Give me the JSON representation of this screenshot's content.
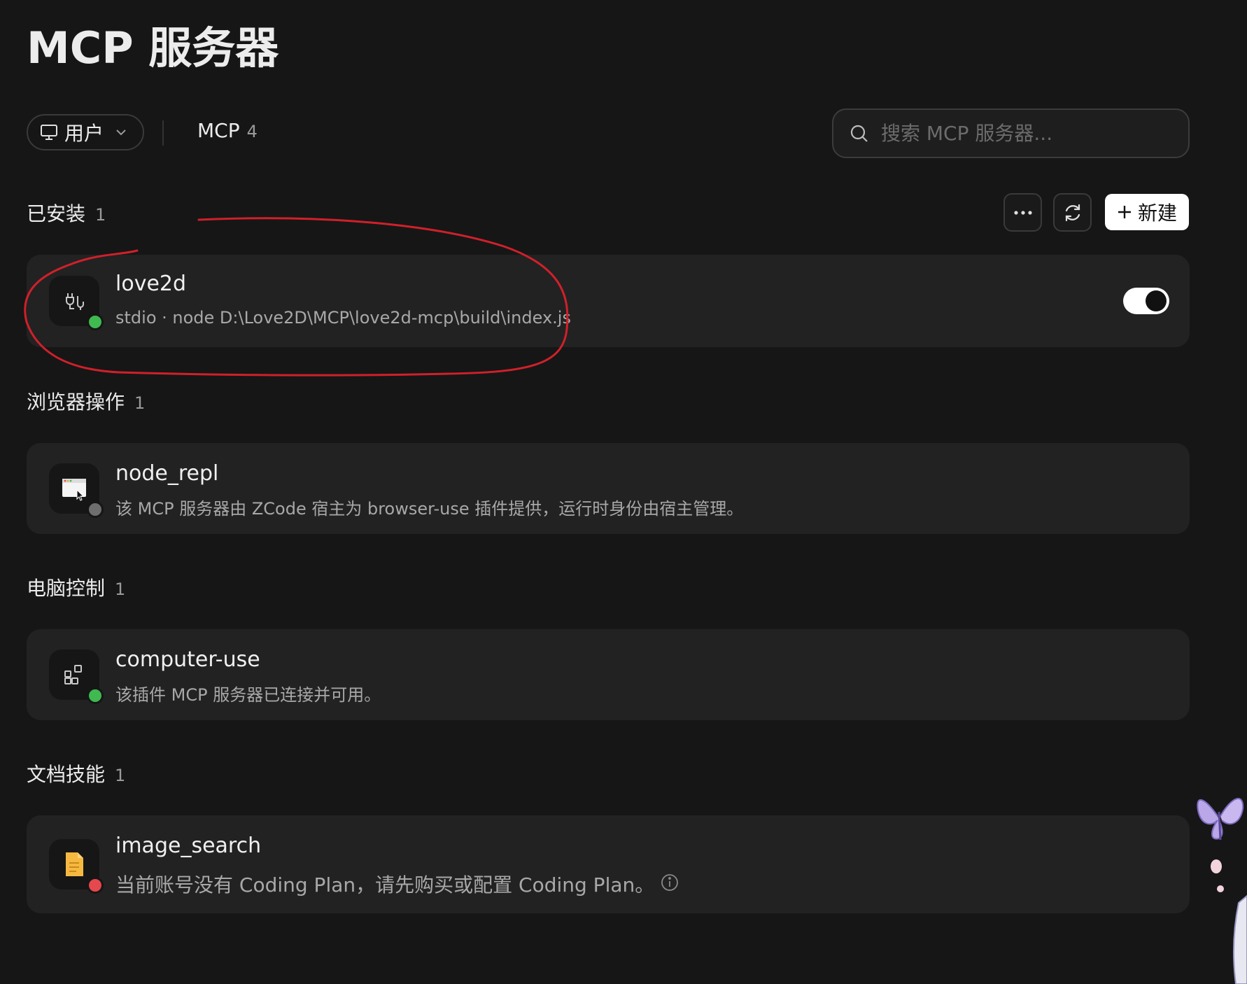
{
  "page": {
    "title": "MCP 服务器"
  },
  "toolbar": {
    "scope_label": "用户",
    "mcp_label": "MCP",
    "mcp_count": "4",
    "search_placeholder": "搜索 MCP 服务器..."
  },
  "actions": {
    "more_label": "···",
    "new_label": "新建"
  },
  "sections": [
    {
      "label": "已安装",
      "count": "1",
      "card": {
        "name": "love2d",
        "desc": "stdio · node D:\\Love2D\\MCP\\love2d-mcp\\build\\index.js",
        "status_color": "#3fb950",
        "enabled": true,
        "icon": "plug-icon"
      }
    },
    {
      "label": "浏览器操作",
      "count": "1",
      "card": {
        "name": "node_repl",
        "desc": "该 MCP 服务器由 ZCode 宿主为 browser-use 插件提供，运行时身份由宿主管理。",
        "status_color": "#6e6e6e",
        "icon": "browser-window-icon"
      }
    },
    {
      "label": "电脑控制",
      "count": "1",
      "card": {
        "name": "computer-use",
        "desc": "该插件 MCP 服务器已连接并可用。",
        "status_color": "#3fb950",
        "icon": "apps-grid-icon"
      }
    },
    {
      "label": "文档技能",
      "count": "1",
      "card": {
        "name": "image_search",
        "desc": "当前账号没有 Coding Plan，请先购买或配置 Coding Plan。",
        "status_color": "#e5484d",
        "icon": "document-icon"
      }
    }
  ],
  "colors": {
    "background": "#161616",
    "card": "#222222",
    "annotation": "#d0202a"
  }
}
